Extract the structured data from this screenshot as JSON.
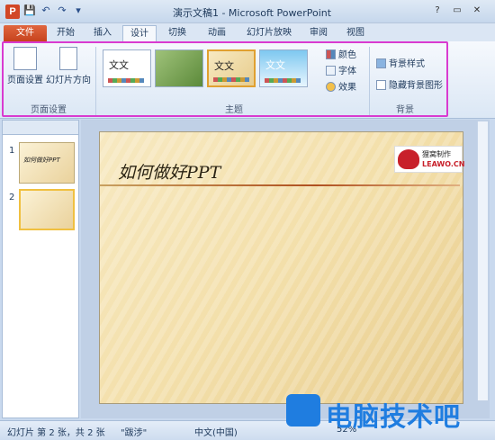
{
  "window": {
    "title": "演示文稿1 - Microsoft PowerPoint",
    "app_icon": "P"
  },
  "qat": {
    "save": "💾",
    "undo": "↶",
    "redo": "↷",
    "more": "▾"
  },
  "controls": {
    "help": "?",
    "minimize": "▭",
    "maximize": "▢",
    "close": "✕"
  },
  "tabs": [
    "文件",
    "开始",
    "插入",
    "设计",
    "切换",
    "动画",
    "幻灯片放映",
    "审阅",
    "视图"
  ],
  "active_tab": "设计",
  "ribbon": {
    "page_setup": {
      "btn1": "页面设置",
      "btn2": "幻灯片方向",
      "label": "页面设置"
    },
    "themes": {
      "label": "主题",
      "items": [
        "文文",
        "",
        "文文",
        "文文"
      ]
    },
    "theme_options": {
      "colors": "颜色",
      "fonts": "字体",
      "effects": "效果"
    },
    "background": {
      "style": "背景样式",
      "hide": "隐藏背景图形",
      "label": "背景"
    }
  },
  "left_pane": {
    "thumbs": [
      {
        "num": "1",
        "text": "如何做好PPT"
      },
      {
        "num": "2",
        "text": ""
      }
    ]
  },
  "slide": {
    "title": "如何做好PPT",
    "brand_cn": "狸窝制作",
    "brand_en": "LEAWO.CN"
  },
  "status": {
    "slide_info": "幻灯片 第 2 张，共 2 张",
    "theme": "\"跋涉\"",
    "language": "中文(中国)",
    "zoom": "52%"
  },
  "watermark": {
    "text": "电脑技术吧"
  },
  "colors": {
    "file_tab": "#d24726",
    "highlight": "#d93bd0",
    "watermark": "#1f7de0"
  }
}
